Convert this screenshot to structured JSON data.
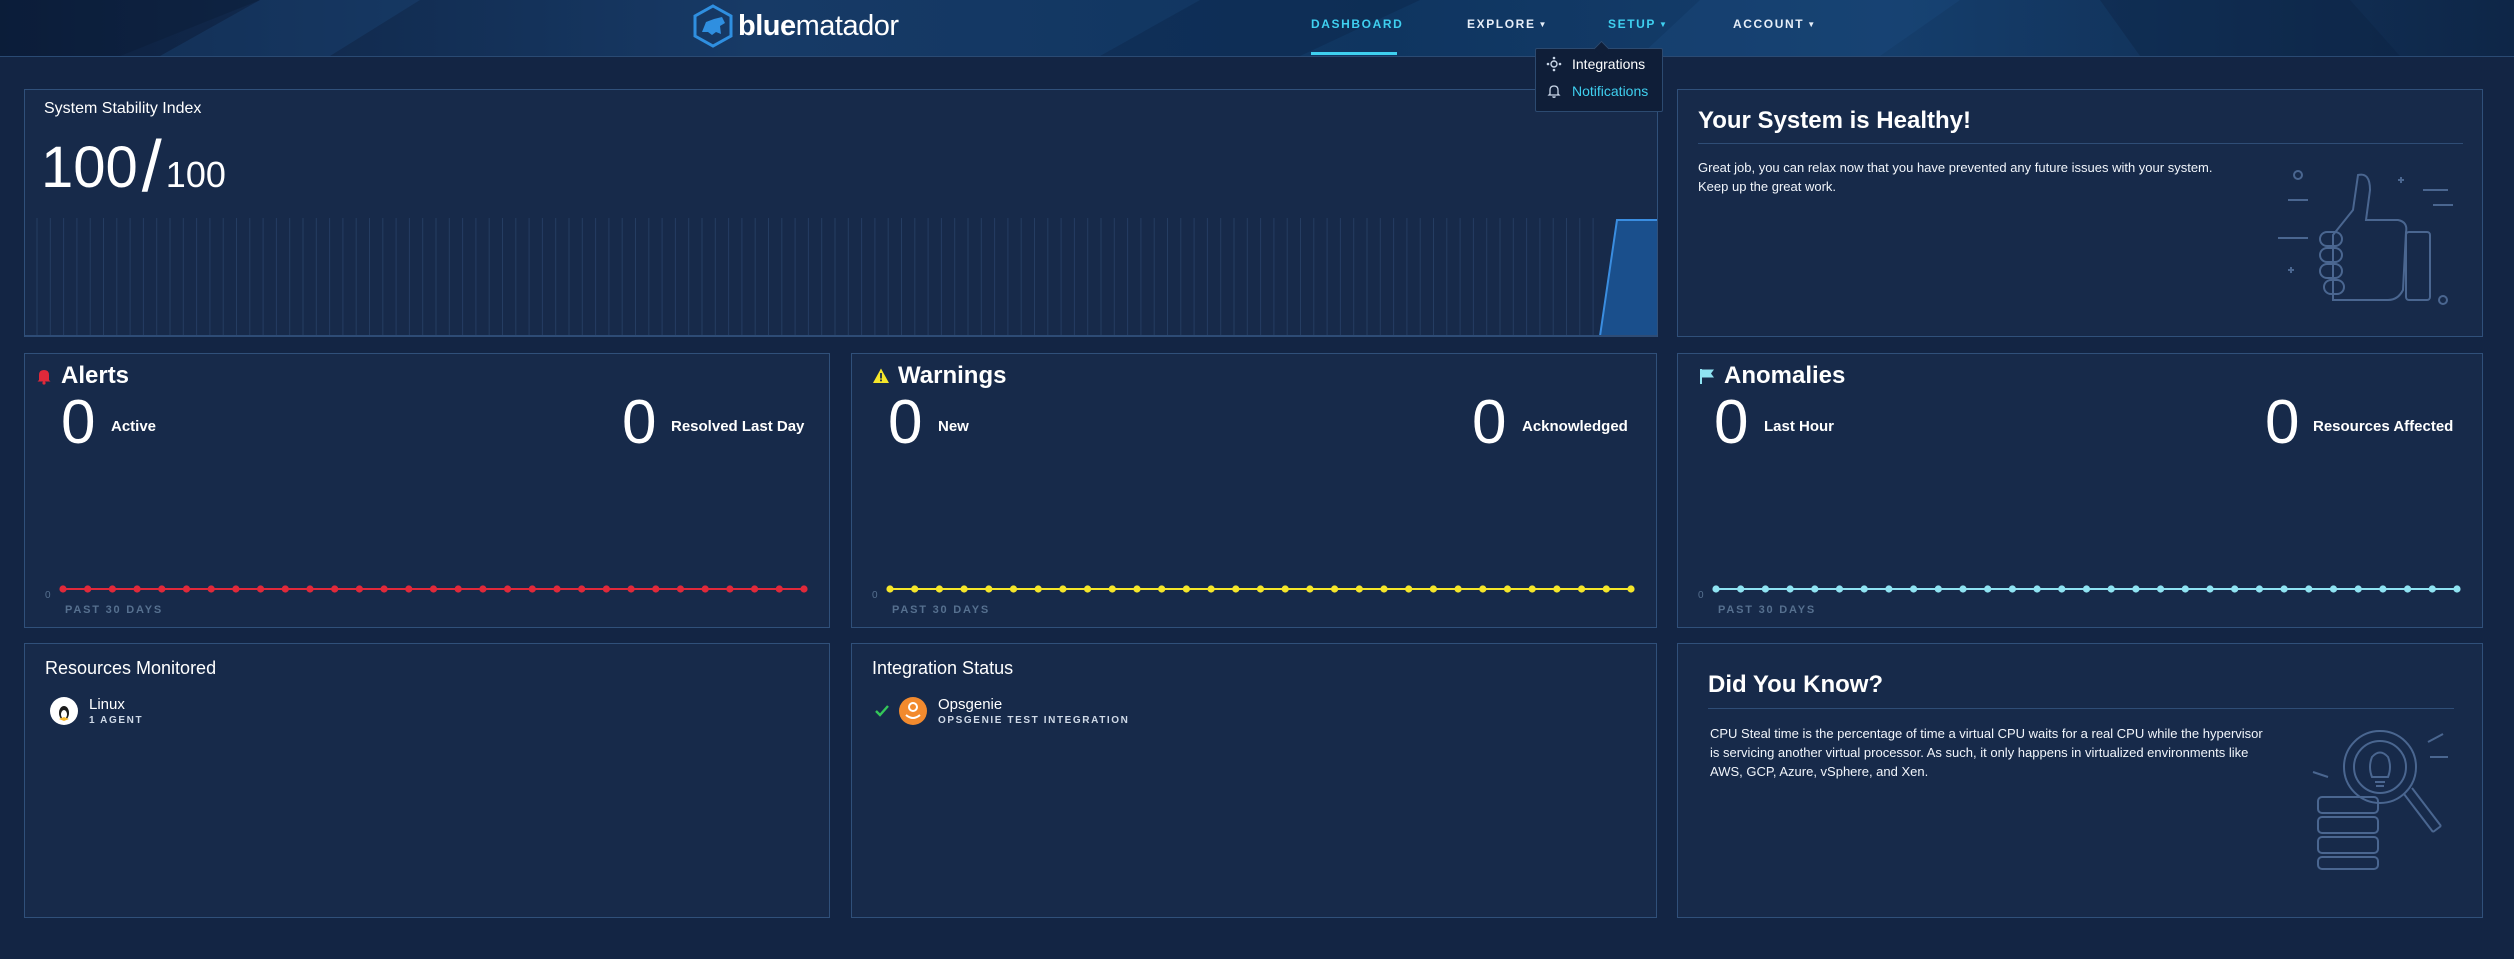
{
  "brand": {
    "name_bold": "blue",
    "name_light": "matador"
  },
  "nav": {
    "dashboard": "DASHBOARD",
    "explore": "EXPLORE",
    "setup": "SETUP",
    "account": "ACCOUNT"
  },
  "setup_menu": {
    "items": [
      {
        "label": "Integrations",
        "icon": "integrations-icon"
      },
      {
        "label": "Notifications",
        "icon": "bell-icon"
      }
    ]
  },
  "stability": {
    "title": "System Stability Index",
    "value": "100",
    "max": "100"
  },
  "healthy": {
    "title": "Your System is Healthy!",
    "text": "Great job, you can relax now that you have prevented any future issues with your system. Keep up the great work."
  },
  "alerts": {
    "title": "Alerts",
    "active_value": "0",
    "active_label": "Active",
    "resolved_value": "0",
    "resolved_label": "Resolved Last Day",
    "axis_zero": "0",
    "period": "PAST 30 DAYS",
    "color": "#e0293a",
    "series": [
      0,
      0,
      0,
      0,
      0,
      0,
      0,
      0,
      0,
      0,
      0,
      0,
      0,
      0,
      0,
      0,
      0,
      0,
      0,
      0,
      0,
      0,
      0,
      0,
      0,
      0,
      0,
      0,
      0,
      0,
      0
    ]
  },
  "warnings": {
    "title": "Warnings",
    "new_value": "0",
    "new_label": "New",
    "ack_value": "0",
    "ack_label": "Acknowledged",
    "axis_zero": "0",
    "period": "PAST 30 DAYS",
    "color": "#f5e62a",
    "series": [
      0,
      0,
      0,
      0,
      0,
      0,
      0,
      0,
      0,
      0,
      0,
      0,
      0,
      0,
      0,
      0,
      0,
      0,
      0,
      0,
      0,
      0,
      0,
      0,
      0,
      0,
      0,
      0,
      0,
      0,
      0
    ]
  },
  "anomalies": {
    "title": "Anomalies",
    "hour_value": "0",
    "hour_label": "Last Hour",
    "res_value": "0",
    "res_label": "Resources Affected",
    "axis_zero": "0",
    "period": "PAST 30 DAYS",
    "color": "#8fe3f2",
    "series": [
      0,
      0,
      0,
      0,
      0,
      0,
      0,
      0,
      0,
      0,
      0,
      0,
      0,
      0,
      0,
      0,
      0,
      0,
      0,
      0,
      0,
      0,
      0,
      0,
      0,
      0,
      0,
      0,
      0,
      0,
      0
    ]
  },
  "resources": {
    "title": "Resources Monitored",
    "items": [
      {
        "name": "Linux",
        "sub": "1 AGENT",
        "icon": "linux-icon"
      }
    ]
  },
  "integrations": {
    "title": "Integration Status",
    "items": [
      {
        "name": "Opsgenie",
        "sub": "OPSGENIE TEST INTEGRATION",
        "status_icon": "check-icon",
        "icon": "opsgenie-icon"
      }
    ]
  },
  "did_you_know": {
    "title": "Did You Know?",
    "text": "CPU Steal time is the percentage of time a virtual CPU waits for a real CPU while the hypervisor is servicing another virtual processor. As such, it only happens in virtualized environments like AWS, GCP, Azure, vSphere, and Xen."
  },
  "colors": {
    "accent": "#3fd0f0",
    "background": "#132544",
    "panel": "#172a4a",
    "border": "#30507a"
  }
}
